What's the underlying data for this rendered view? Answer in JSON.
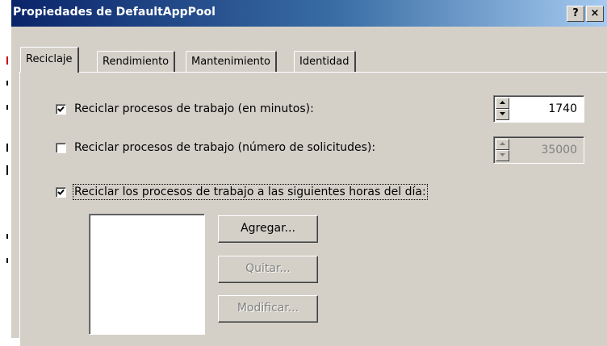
{
  "window": {
    "title": "Propiedades de DefaultAppPool",
    "help_label": "?",
    "close_label": "×"
  },
  "tabs": [
    {
      "label": "Reciclaje",
      "active": true
    },
    {
      "label": "Rendimiento",
      "active": false
    },
    {
      "label": "Mantenimiento",
      "active": false
    },
    {
      "label": "Identidad",
      "active": false
    }
  ],
  "recycle_minutes": {
    "label": "Reciclar procesos de trabajo (en minutos):",
    "checked": true,
    "value": "1740"
  },
  "recycle_requests": {
    "label": "Reciclar procesos de trabajo (número de solicitudes):",
    "checked": false,
    "value": "35000"
  },
  "recycle_times": {
    "label": "Reciclar los procesos de trabajo a las siguientes horas del día:",
    "checked": true
  },
  "buttons": {
    "add": "Agregar...",
    "remove": "Quitar...",
    "modify": "Modificar..."
  }
}
